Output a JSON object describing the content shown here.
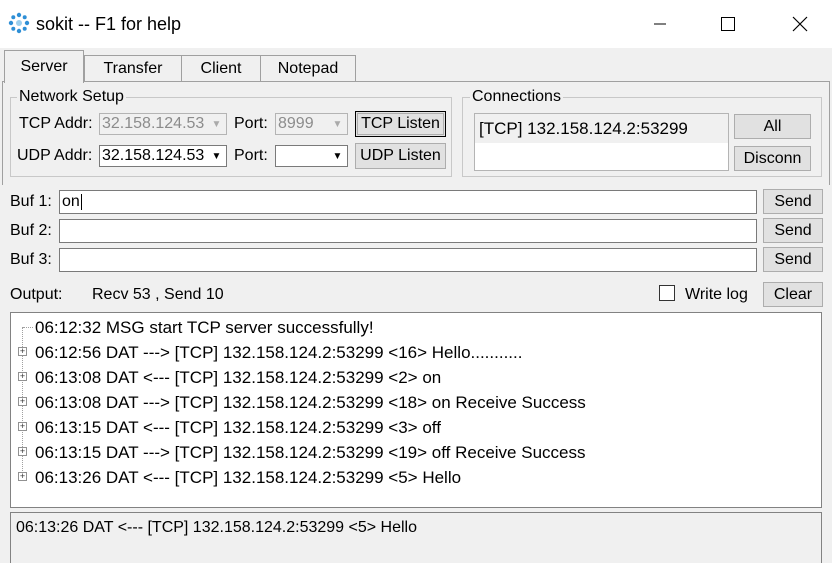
{
  "window": {
    "title": "sokit -- F1 for help",
    "minimize_glyph": "—",
    "maximize_glyph": "☐",
    "close_glyph": "✕"
  },
  "tabs": [
    {
      "label": "Server",
      "active": true
    },
    {
      "label": "Transfer",
      "active": false
    },
    {
      "label": "Client",
      "active": false
    },
    {
      "label": "Notepad",
      "active": false
    }
  ],
  "network_setup": {
    "label": "Network Setup",
    "tcp_addr_label": "TCP Addr:",
    "tcp_addr_value": "32.158.124.53",
    "tcp_port_label": "Port:",
    "tcp_port_value": "8999",
    "tcp_listen_label": "TCP Listen",
    "udp_addr_label": "UDP Addr:",
    "udp_addr_value": "32.158.124.53",
    "udp_port_label": "Port:",
    "udp_port_value": "",
    "udp_listen_label": "UDP Listen"
  },
  "connections": {
    "label": "Connections",
    "items": [
      "[TCP] 132.158.124.2:53299"
    ],
    "all_label": "All",
    "disconn_label": "Disconn"
  },
  "buffers": [
    {
      "label": "Buf 1:",
      "value": "on",
      "send_label": "Send"
    },
    {
      "label": "Buf 2:",
      "value": "",
      "send_label": "Send"
    },
    {
      "label": "Buf 3:",
      "value": "",
      "send_label": "Send"
    }
  ],
  "output": {
    "label": "Output:",
    "stats": "Recv 53 , Send 10",
    "write_log_label": "Write log",
    "write_log_checked": false,
    "clear_label": "Clear"
  },
  "log": [
    {
      "text": "06:12:32 MSG start TCP server successfully!",
      "expandable": false
    },
    {
      "text": "06:12:56 DAT ---> [TCP] 132.158.124.2:53299 <16> Hello...........",
      "expandable": true
    },
    {
      "text": "06:13:08 DAT <--- [TCP] 132.158.124.2:53299 <2> on",
      "expandable": true
    },
    {
      "text": "06:13:08 DAT ---> [TCP] 132.158.124.2:53299 <18> on Receive Success",
      "expandable": true
    },
    {
      "text": "06:13:15 DAT <--- [TCP] 132.158.124.2:53299 <3> off",
      "expandable": true
    },
    {
      "text": "06:13:15 DAT ---> [TCP] 132.158.124.2:53299 <19> off Receive Success",
      "expandable": true
    },
    {
      "text": "06:13:26 DAT <--- [TCP] 132.158.124.2:53299 <5> Hello",
      "expandable": true
    }
  ],
  "status": {
    "text": "06:13:26 DAT <--- [TCP] 132.158.124.2:53299 <5> Hello"
  }
}
